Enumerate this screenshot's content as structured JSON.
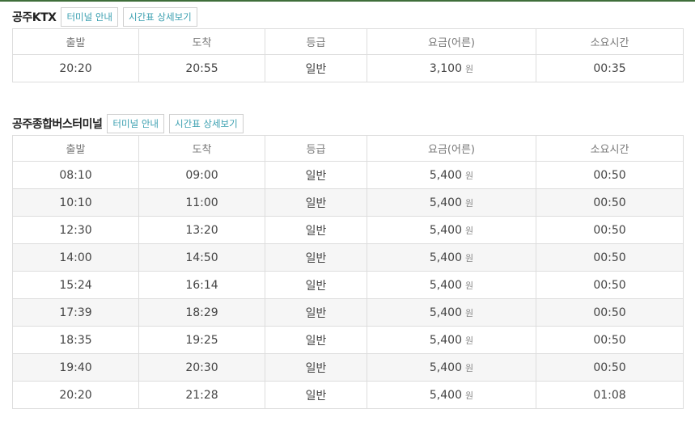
{
  "ktx": {
    "title": "공주KTX",
    "btn_terminal": "터미널 안내",
    "btn_timetable": "시간표 상세보기",
    "headers": [
      "출발",
      "도착",
      "등급",
      "요금(어른)",
      "소요시간"
    ],
    "rows": [
      {
        "dep": "20:20",
        "arr": "20:55",
        "grade": "일반",
        "fare": "3,100",
        "unit": "원",
        "dur": "00:35"
      }
    ]
  },
  "bus": {
    "title": "공주종합버스터미널",
    "btn_terminal": "터미널 안내",
    "btn_timetable": "시간표 상세보기",
    "headers": [
      "출발",
      "도착",
      "등급",
      "요금(어른)",
      "소요시간"
    ],
    "rows": [
      {
        "dep": "08:10",
        "arr": "09:00",
        "grade": "일반",
        "fare": "5,400",
        "unit": "원",
        "dur": "00:50"
      },
      {
        "dep": "10:10",
        "arr": "11:00",
        "grade": "일반",
        "fare": "5,400",
        "unit": "원",
        "dur": "00:50"
      },
      {
        "dep": "12:30",
        "arr": "13:20",
        "grade": "일반",
        "fare": "5,400",
        "unit": "원",
        "dur": "00:50"
      },
      {
        "dep": "14:00",
        "arr": "14:50",
        "grade": "일반",
        "fare": "5,400",
        "unit": "원",
        "dur": "00:50"
      },
      {
        "dep": "15:24",
        "arr": "16:14",
        "grade": "일반",
        "fare": "5,400",
        "unit": "원",
        "dur": "00:50"
      },
      {
        "dep": "17:39",
        "arr": "18:29",
        "grade": "일반",
        "fare": "5,400",
        "unit": "원",
        "dur": "00:50"
      },
      {
        "dep": "18:35",
        "arr": "19:25",
        "grade": "일반",
        "fare": "5,400",
        "unit": "원",
        "dur": "00:50"
      },
      {
        "dep": "19:40",
        "arr": "20:30",
        "grade": "일반",
        "fare": "5,400",
        "unit": "원",
        "dur": "00:50"
      },
      {
        "dep": "20:20",
        "arr": "21:28",
        "grade": "일반",
        "fare": "5,400",
        "unit": "원",
        "dur": "01:08"
      }
    ]
  }
}
